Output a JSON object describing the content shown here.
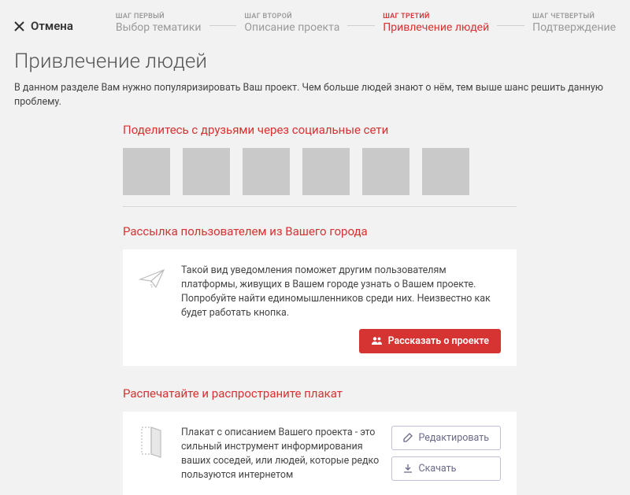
{
  "header": {
    "cancel": "Отмена",
    "steps": [
      {
        "label": "ШАГ ПЕРВЫЙ",
        "title": "Выбор тематики"
      },
      {
        "label": "ШАГ ВТОРОЙ",
        "title": "Описание проекта"
      },
      {
        "label": "ШАГ ТРЕТИЙ",
        "title": "Привлечение людей"
      },
      {
        "label": "ШАГ ЧЕТВЕРТЫЙ",
        "title": "Подтверждение"
      }
    ],
    "active_step": 2
  },
  "page": {
    "title": "Привлечение людей",
    "desc": "В данном разделе Вам нужно популяризировать Ваш проект. Чем больше людей знают о нём, тем выше шанс решить данную проблему."
  },
  "sections": {
    "social": {
      "title": "Поделитесь с друзьями через социальные сети"
    },
    "city": {
      "title": "Рассылка пользователем из Вашего города",
      "body": "Такой вид уведомления поможет другим пользователям платформы, живущих в Вашем городе узнать о Вашем проекте. Попробуйте найти единомышленников среди них. Неизвестно как будет работать кнопка.",
      "button": "Рассказать о проекте"
    },
    "poster": {
      "title": "Распечатайте и распространите плакат",
      "body": "Плакат с описанием Вашего проекта - это сильный инструмент информирования ваших соседей, или людей, которые редко пользуются интернетом",
      "edit": "Редактировать",
      "download": "Скачать"
    }
  }
}
